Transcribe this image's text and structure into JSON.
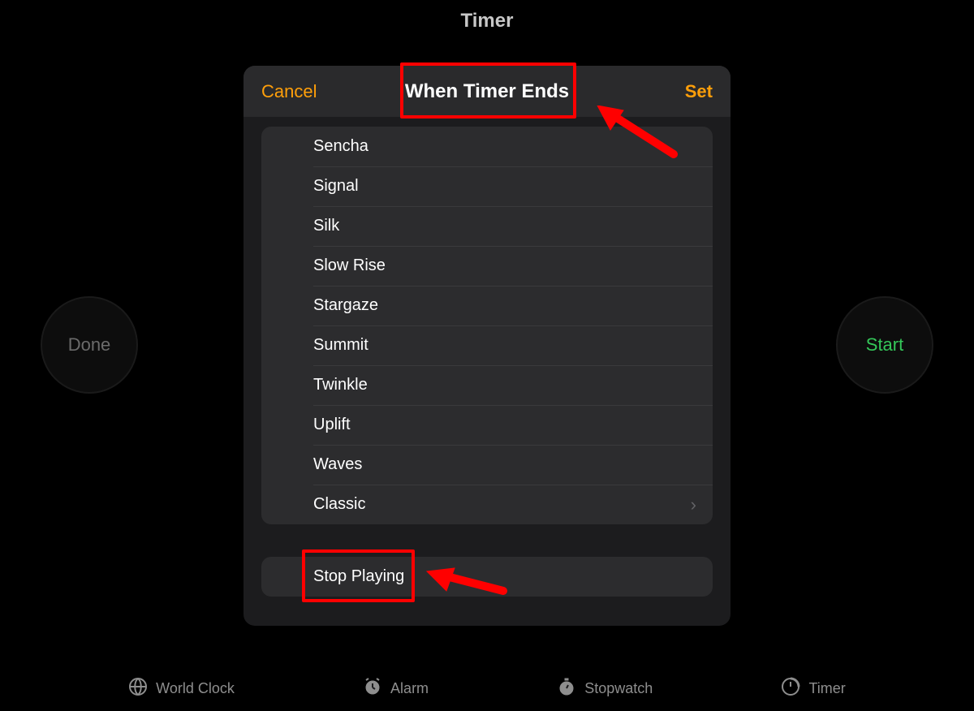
{
  "background": {
    "title": "Timer",
    "done_label": "Done",
    "start_label": "Start"
  },
  "tabs": {
    "world_clock": "World Clock",
    "alarm": "Alarm",
    "stopwatch": "Stopwatch",
    "timer": "Timer"
  },
  "sheet": {
    "cancel_label": "Cancel",
    "title": "When Timer Ends",
    "set_label": "Set",
    "items": [
      "Sencha",
      "Signal",
      "Silk",
      "Slow Rise",
      "Stargaze",
      "Summit",
      "Twinkle",
      "Uplift",
      "Waves"
    ],
    "classic_label": "Classic",
    "stop_label": "Stop Playing"
  },
  "colors": {
    "accent_orange": "#ff9f0a",
    "accent_green": "#34c759",
    "highlight_red": "#ff0000"
  }
}
